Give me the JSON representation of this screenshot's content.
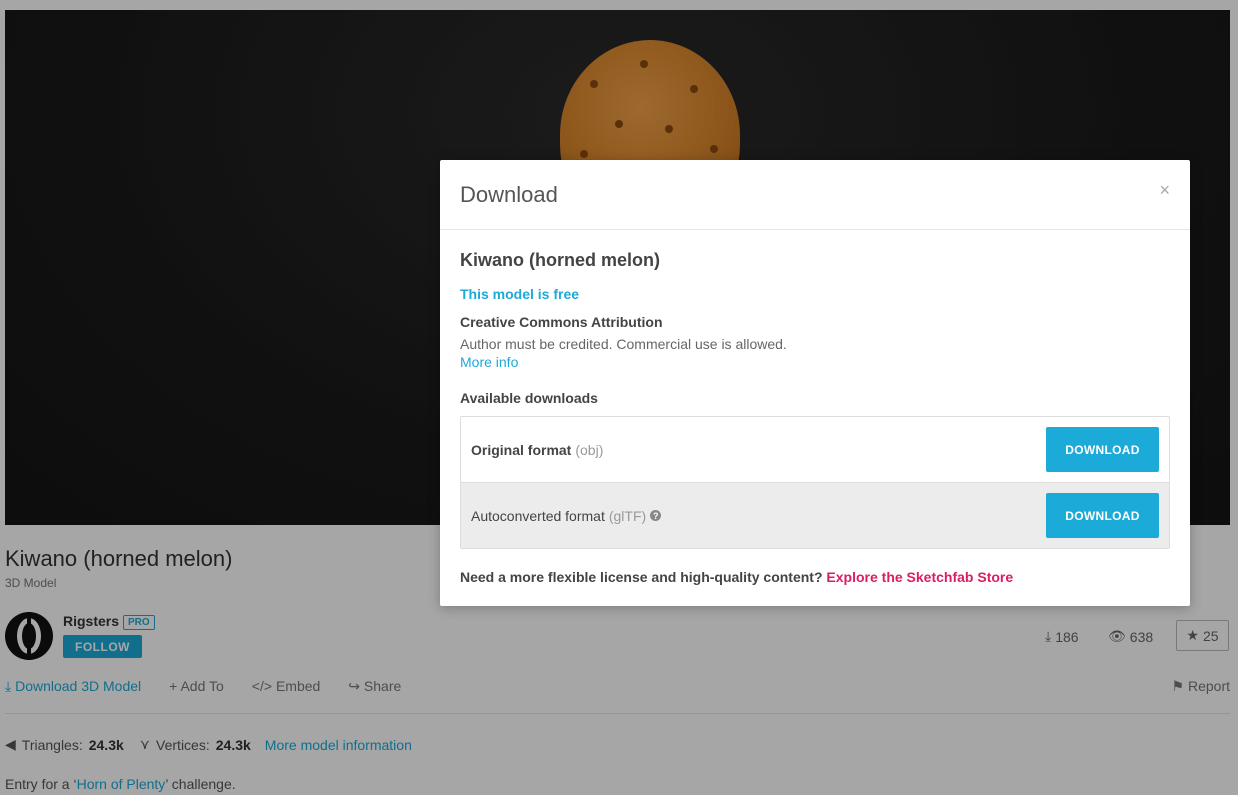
{
  "background": {
    "model_title": "Kiwano (horned melon)",
    "model_subtitle": "3D Model",
    "author": {
      "name": "Rigsters",
      "badge": "PRO",
      "follow_label": "FOLLOW"
    },
    "stats": {
      "downloads": "186",
      "views": "638",
      "likes": "25"
    },
    "actions": {
      "download": "Download 3D Model",
      "add_to": "Add To",
      "embed": "Embed",
      "share": "Share",
      "report": "Report"
    },
    "model_info": {
      "triangles_label": "Triangles:",
      "triangles_value": "24.3k",
      "vertices_label": "Vertices:",
      "vertices_value": "24.3k",
      "more_info": "More model information"
    },
    "entry": {
      "prefix": "Entry for a ‘",
      "link": "Horn of Plenty",
      "suffix": "’ challenge."
    }
  },
  "modal": {
    "title": "Download",
    "close": "×",
    "model_name": "Kiwano (horned melon)",
    "free_text": "This model is free",
    "license_title": "Creative Commons Attribution",
    "license_desc": "Author must be credited. Commercial use is allowed.",
    "more_info": "More info",
    "available_title": "Available downloads",
    "downloads": [
      {
        "label": "Original format",
        "ext": "(obj)",
        "button": "DOWNLOAD"
      },
      {
        "label": "Autoconverted format",
        "ext": "(glTF)",
        "button": "DOWNLOAD"
      }
    ],
    "footer_text": "Need a more flexible license and high-quality content?",
    "footer_link": "Explore the Sketchfab Store"
  },
  "colors": {
    "accent": "#1caad9",
    "store_link": "#d91e63"
  }
}
